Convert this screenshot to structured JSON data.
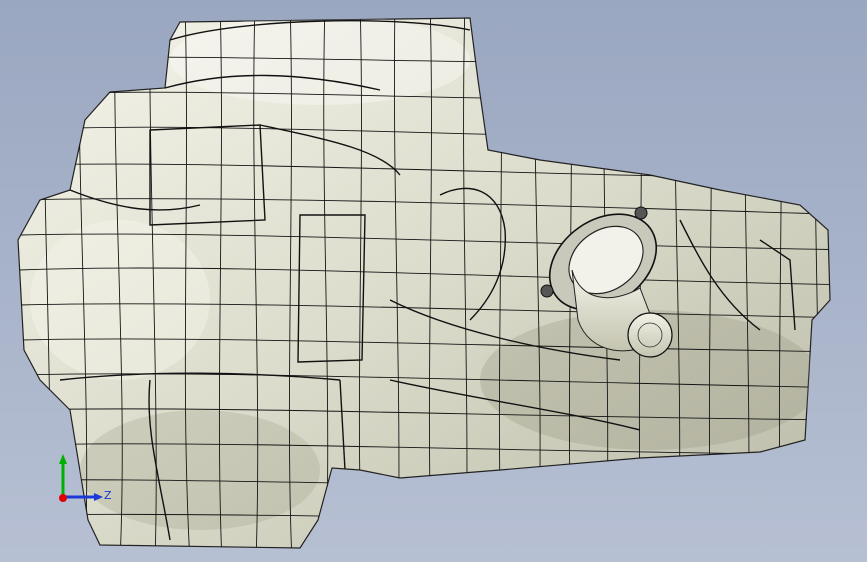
{
  "view": {
    "background_top": "#9aa7c0",
    "background_bottom": "#b7c0d3"
  },
  "model": {
    "surface_color": "#e6e6d8",
    "mesh_line_color": "#1a1a1a",
    "description_icon": "engine-mesh-model"
  },
  "triad": {
    "x_color": "#e00000",
    "y_color": "#00b000",
    "z_color": "#1c38d6",
    "z_label": "Z"
  }
}
